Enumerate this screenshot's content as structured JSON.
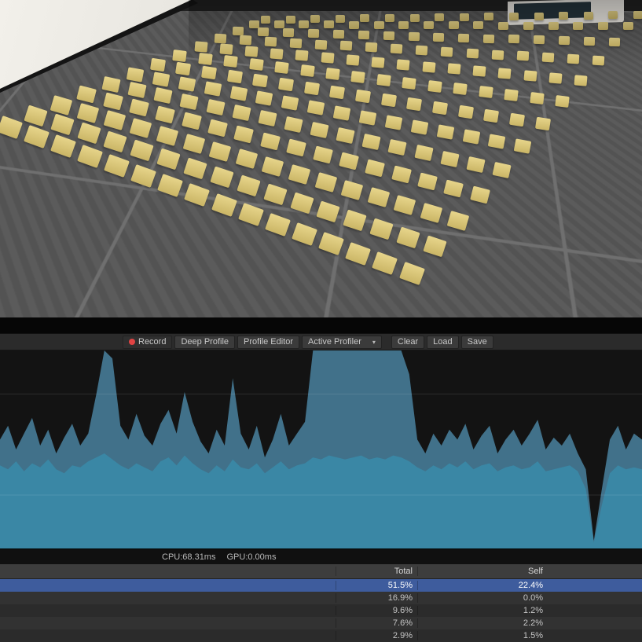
{
  "toolbar": {
    "buttons": [
      {
        "id": "record",
        "label": "Record",
        "icon": "record-dot",
        "active": true
      },
      {
        "id": "deep-profile",
        "label": "Deep Profile"
      },
      {
        "id": "profile-editor",
        "label": "Profile Editor"
      },
      {
        "id": "active-profiler",
        "label": "Active Profiler",
        "dropdown": true
      },
      {
        "id": "clear",
        "label": "Clear",
        "gap_before": true
      },
      {
        "id": "load",
        "label": "Load"
      },
      {
        "id": "save",
        "label": "Save"
      }
    ]
  },
  "frame_stats": {
    "cpu": "CPU:68.31ms",
    "gpu": "GPU:0.00ms"
  },
  "table": {
    "headers": {
      "total": "Total",
      "self": "Self"
    },
    "selected_color": "#3e5c9d",
    "rows": [
      {
        "total": "51.5%",
        "self": "22.4%",
        "selected": true
      },
      {
        "total": "16.9%",
        "self": "0.0%",
        "selected": false
      },
      {
        "total": "9.6%",
        "self": "1.2%",
        "selected": false
      },
      {
        "total": "7.6%",
        "self": "2.2%",
        "selected": false
      },
      {
        "total": "2.9%",
        "self": "1.5%",
        "selected": false
      }
    ]
  },
  "chart_data": {
    "type": "area",
    "ylim": [
      0,
      100
    ],
    "unit": "percent-of-chart-height",
    "grid": true,
    "gridlines": [
      0.27,
      0.78
    ],
    "background": "#131313",
    "series": [
      {
        "name": "cpu-total",
        "color": "#41718a",
        "values": [
          55,
          62,
          50,
          58,
          66,
          52,
          60,
          48,
          56,
          63,
          52,
          58,
          78,
          100,
          96,
          62,
          55,
          68,
          57,
          52,
          63,
          70,
          58,
          79,
          64,
          54,
          48,
          60,
          52,
          86,
          58,
          50,
          62,
          46,
          55,
          68,
          52,
          58,
          64,
          100,
          100,
          100,
          100,
          100,
          100,
          100,
          100,
          100,
          100,
          100,
          100,
          88,
          55,
          48,
          58,
          52,
          60,
          55,
          63,
          50,
          57,
          62,
          48,
          55,
          60,
          52,
          58,
          65,
          50,
          56,
          52,
          58,
          48,
          40,
          4,
          30,
          55,
          62,
          50,
          58,
          55
        ]
      },
      {
        "name": "cpu-base",
        "color": "#3a87a5",
        "values": [
          42,
          40,
          44,
          39,
          43,
          41,
          45,
          40,
          38,
          42,
          41,
          44,
          46,
          48,
          45,
          42,
          40,
          43,
          41,
          39,
          44,
          46,
          42,
          47,
          43,
          40,
          38,
          42,
          39,
          45,
          41,
          40,
          43,
          38,
          41,
          44,
          40,
          42,
          43,
          46,
          45,
          47,
          46,
          45,
          46,
          47,
          45,
          46,
          45,
          47,
          46,
          44,
          41,
          39,
          42,
          40,
          43,
          41,
          44,
          40,
          42,
          43,
          39,
          41,
          42,
          40,
          41,
          44,
          39,
          40,
          41,
          42,
          39,
          30,
          3,
          22,
          38,
          42,
          40,
          41,
          40
        ]
      }
    ]
  },
  "scene": {
    "sprite_grid": {
      "rows": 13,
      "cols": 16
    },
    "colors": {
      "sprite_light": "#e8d68c",
      "sprite_dark": "#c9b464",
      "floor": "#565656",
      "grout": "#6f6f6f",
      "wall": "#ece9e3",
      "kiosk_screen": "#26343c"
    }
  }
}
